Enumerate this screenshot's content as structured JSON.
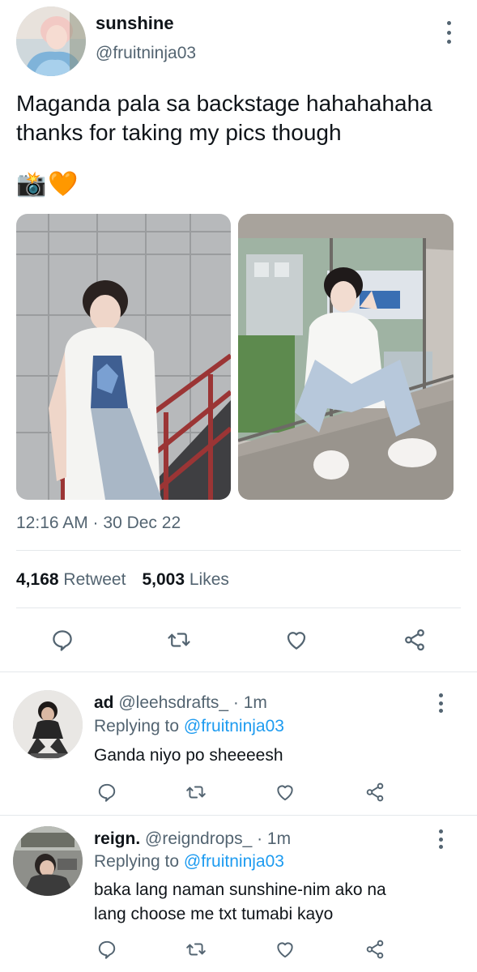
{
  "tweet": {
    "display_name": "sunshine",
    "handle": "@fruitninja03",
    "text_line1": "Maganda pala sa backstage hahahahaha",
    "text_line2": "thanks for taking my pics though",
    "emojis": [
      "📸",
      "🧡"
    ],
    "timestamp": "12:16 AM · 30 Dec 22",
    "retweets_count": "4,168",
    "retweets_label": "Retweet",
    "likes_count": "5,003",
    "likes_label": "Likes"
  },
  "replies": [
    {
      "name": "ad",
      "meta": "@leehsdrafts_ · 1m",
      "replying_label": "Replying to",
      "replying_handle": "@fruitninja03",
      "text_line1": "Ganda niyo po sheeeesh",
      "text_line2": ""
    },
    {
      "name": "reign.",
      "meta": "@reigndrops_ · 1m",
      "replying_label": "Replying to",
      "replying_handle": "@fruitninja03",
      "text_line1": "baka lang naman sunshine-nim ako na",
      "text_line2": "lang choose me txt tumabi kayo"
    }
  ],
  "icons": {
    "reply": "reply-icon",
    "retweet": "retweet-icon",
    "like": "heart-icon",
    "share": "share-icon",
    "more": "more-vertical-icon"
  },
  "colors": {
    "text": "#0f1419",
    "secondary": "#536471",
    "link": "#1d9bf0",
    "divider": "#e4e8eb"
  }
}
